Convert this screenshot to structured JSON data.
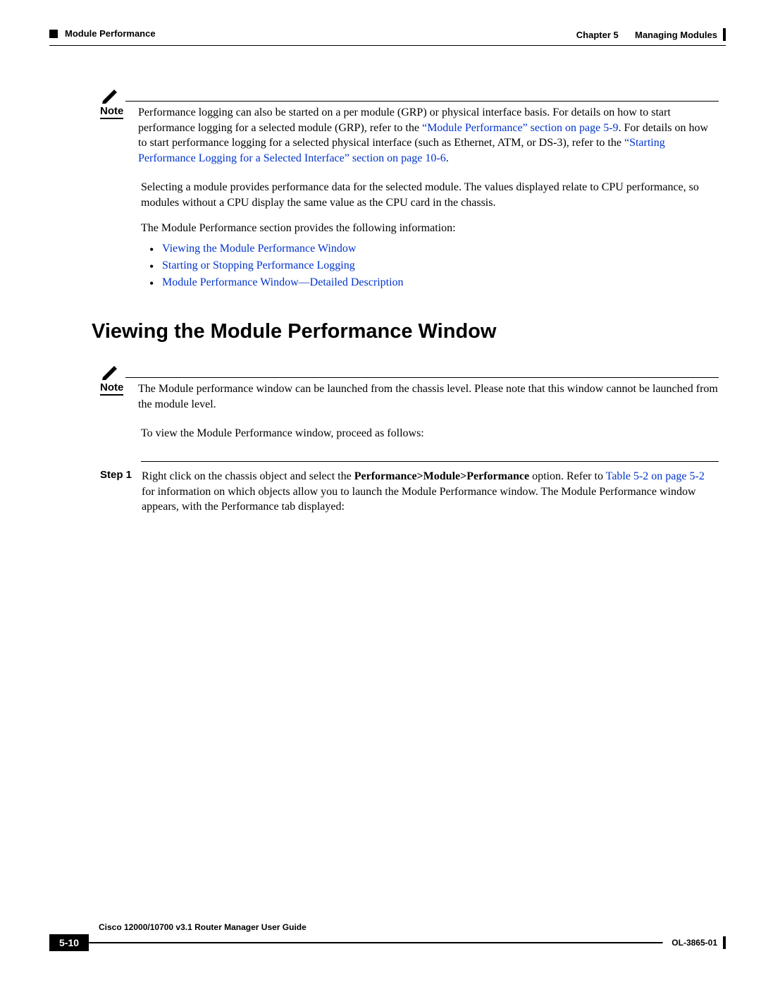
{
  "header": {
    "chapter_label": "Chapter 5",
    "chapter_title": "Managing Modules",
    "section_title": "Module Performance"
  },
  "note1": {
    "label": "Note",
    "text_part1": "Performance logging can also be started on a per module (GRP) or physical interface basis. For details on how to start performance logging for a selected module (GRP), refer to the ",
    "link1": "“Module Performance” section on page 5-9",
    "text_part2": ". For details on how to start performance logging for a selected physical interface (such as Ethernet, ATM, or DS-3), refer to the ",
    "link2": "“Starting Performance Logging for a Selected Interface” section on page 10-6",
    "text_part3": "."
  },
  "paras": {
    "p1": "Selecting a module provides performance data for the selected module. The values displayed relate to CPU performance, so modules without a CPU display the same value as the CPU card in the chassis.",
    "p2": "The Module Performance section provides the following information:"
  },
  "bullets": {
    "b1": "Viewing the Module Performance Window",
    "b2": "Starting or Stopping Performance Logging",
    "b3": "Module Performance Window—Detailed Description"
  },
  "heading": "Viewing the Module Performance Window",
  "note2": {
    "label": "Note",
    "text": "The Module performance window can be launched from the chassis level. Please note that this window cannot be launched from the module level."
  },
  "p3": "To view the Module Performance window, proceed as follows:",
  "step1": {
    "label": "Step 1",
    "text_part1": "Right click on the chassis object and select the ",
    "bold": "Performance>Module>Performance",
    "text_part2": " option. Refer to ",
    "link": "Table 5-2 on page 5-2",
    "text_part3": " for information on which objects allow you to launch the Module Performance window. The Module Performance window appears, with the Performance tab displayed:"
  },
  "footer": {
    "guide": "Cisco 12000/10700 v3.1 Router Manager User Guide",
    "page": "5-10",
    "doc": "OL-3865-01"
  }
}
